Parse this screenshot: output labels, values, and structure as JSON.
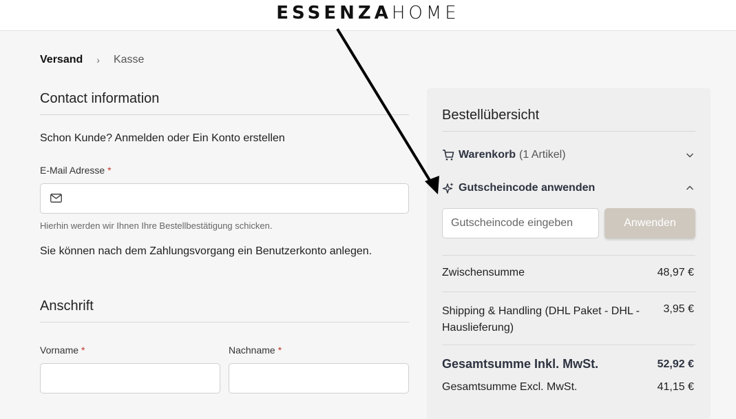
{
  "header": {
    "logo_left": "ESSENZA",
    "logo_right": "HOME"
  },
  "breadcrumb": {
    "active": "Versand",
    "separator": "›",
    "next": "Kasse"
  },
  "contact": {
    "title": "Contact information",
    "login_text": "Schon Kunde? Anmelden oder Ein Konto erstellen",
    "email_label": "E-Mail Adresse",
    "required_mark": "*",
    "email_hint": "Hierhin werden wir Ihnen Ihre Bestellbestätigung schicken.",
    "account_note": "Sie können nach dem Zahlungsvorgang ein Benutzerkonto anlegen."
  },
  "address": {
    "title": "Anschrift",
    "first_name_label": "Vorname",
    "last_name_label": "Nachname"
  },
  "summary": {
    "title": "Bestellübersicht",
    "cart_label": "Warenkorb",
    "cart_count": "(1 Artikel)",
    "coupon_label": "Gutscheincode anwenden",
    "coupon_placeholder": "Gutscheincode eingeben",
    "apply_label": "Anwenden",
    "subtotal_label": "Zwischensumme",
    "subtotal_value": "48,97 €",
    "shipping_label_1": "Shipping & Handling (DHL Paket - DHL -",
    "shipping_label_2": "Hauslieferung)",
    "shipping_value": "3,95 €",
    "total_incl_label": "Gesamtsumme Inkl. MwSt.",
    "total_incl_value": "52,92 €",
    "total_excl_label": "Gesamtsumme Excl. MwSt.",
    "total_excl_value": "41,15 €"
  },
  "colors": {
    "apply_button": "#cfc8bf",
    "required": "#c0392b",
    "panel": "#efefef"
  }
}
